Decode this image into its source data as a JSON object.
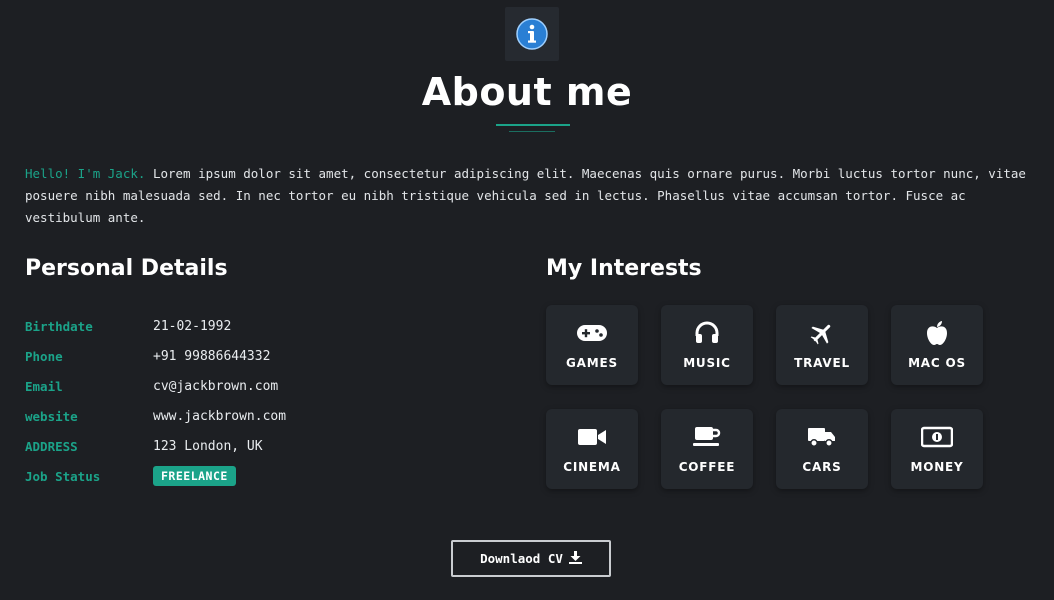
{
  "header": {
    "icon": "info-icon",
    "title": "About me"
  },
  "intro": {
    "greeting": "Hello! I'm Jack.",
    "text": " Lorem ipsum dolor sit amet, consectetur adipiscing elit. Maecenas quis ornare purus. Morbi luctus tortor nunc, vitae posuere nibh malesuada sed. In nec tortor eu nibh tristique vehicula sed in lectus. Phasellus vitae accumsan tortor. Fusce ac vestibulum ante."
  },
  "personal": {
    "title": "Personal Details",
    "rows": [
      {
        "label": "Birthdate",
        "value": "21-02-1992"
      },
      {
        "label": "Phone",
        "value": "+91 99886644332"
      },
      {
        "label": "Email",
        "value": "cv@jackbrown.com"
      },
      {
        "label": "website",
        "value": "www.jackbrown.com"
      },
      {
        "label": "ADDRESS",
        "value": "123 London, UK"
      },
      {
        "label": "Job Status",
        "value": "FREELANCE"
      }
    ]
  },
  "interests": {
    "title": "My Interests",
    "items": [
      {
        "label": "GAMES",
        "icon": "gamepad-icon"
      },
      {
        "label": "MUSIC",
        "icon": "headphones-icon"
      },
      {
        "label": "TRAVEL",
        "icon": "plane-icon"
      },
      {
        "label": "MAC OS",
        "icon": "apple-icon"
      },
      {
        "label": "CINEMA",
        "icon": "video-camera-icon"
      },
      {
        "label": "COFFEE",
        "icon": "coffee-icon"
      },
      {
        "label": "CARS",
        "icon": "truck-icon"
      },
      {
        "label": "MONEY",
        "icon": "money-icon"
      }
    ]
  },
  "actions": {
    "download_label": "Downlaod CV",
    "download_icon": "download-icon"
  },
  "colors": {
    "background": "#1d1f23",
    "accent": "#1ba389",
    "tile": "#24282d"
  }
}
